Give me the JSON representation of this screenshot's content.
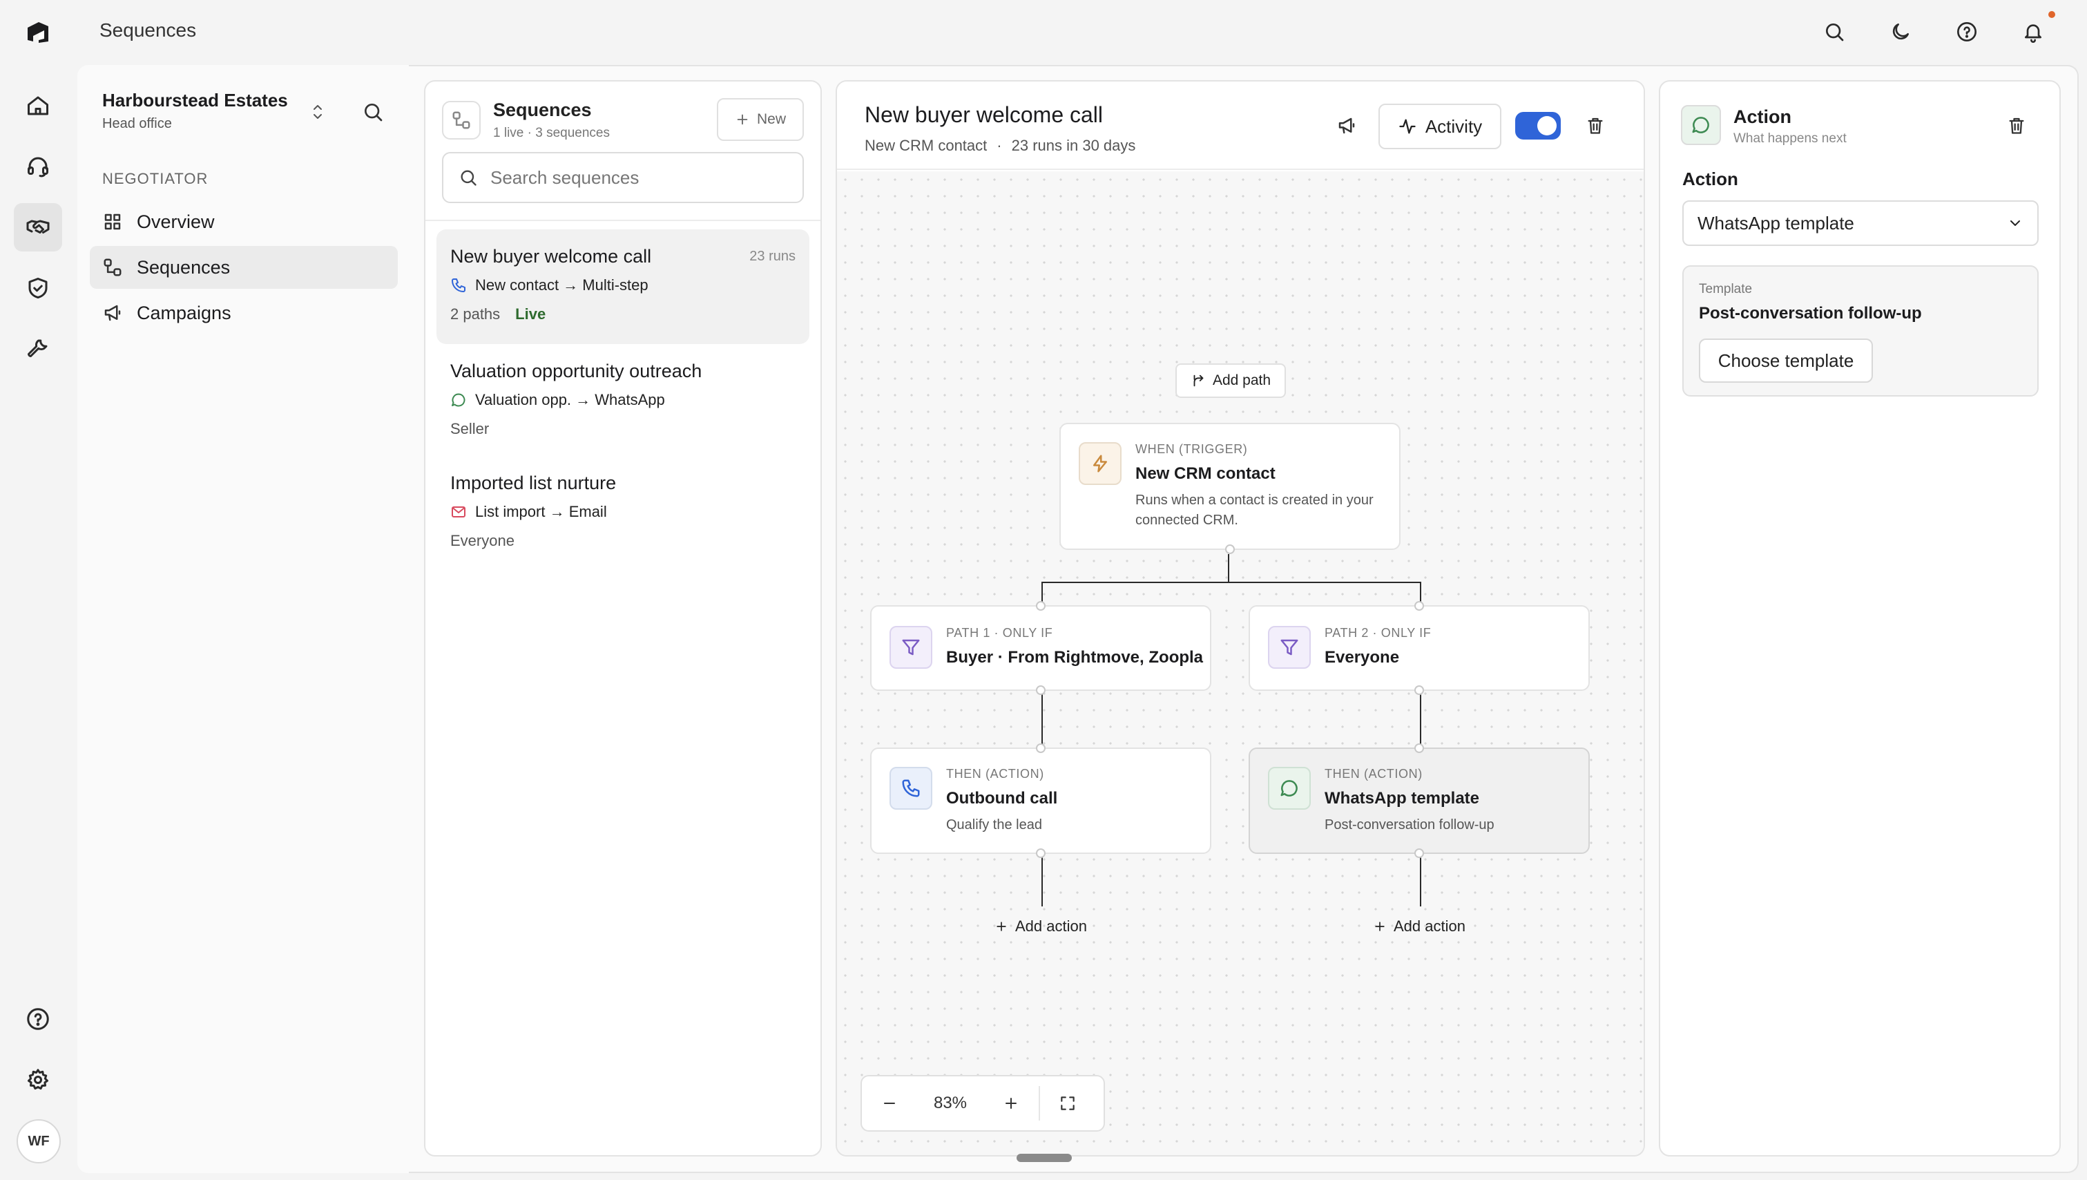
{
  "app": {
    "title": "Sequences"
  },
  "org": {
    "name": "Harbourstead Estates",
    "subtitle": "Head office"
  },
  "user": {
    "initials": "WF"
  },
  "sidebar": {
    "section_label": "NEGOTIATOR",
    "items": [
      {
        "label": "Overview",
        "icon": "grid-icon"
      },
      {
        "label": "Sequences",
        "icon": "sequence-icon",
        "active": true
      },
      {
        "label": "Campaigns",
        "icon": "megaphone-icon"
      }
    ]
  },
  "sequences_panel": {
    "title": "Sequences",
    "subtitle": "1 live · 3 sequences",
    "new_label": "New",
    "search_placeholder": "Search sequences",
    "items": [
      {
        "title": "New buyer welcome call",
        "runs": "23 runs",
        "flow": "New contact → Multi-step",
        "flow_icon": "phone-icon",
        "meta": "2 paths",
        "status": "Live",
        "active": true
      },
      {
        "title": "Valuation opportunity outreach",
        "flow": "Valuation opp. → WhatsApp",
        "flow_icon": "chat-icon",
        "meta": "Seller"
      },
      {
        "title": "Imported list nurture",
        "flow": "List import → Email",
        "flow_icon": "mail-icon",
        "meta": "Everyone"
      }
    ]
  },
  "canvas": {
    "title": "New buyer welcome call",
    "subtitle_trigger": "New CRM contact",
    "subtitle_runs": "23 runs in 30 days",
    "separator": "·",
    "activity_label": "Activity",
    "enabled": true,
    "add_path_label": "Add path",
    "add_action_label": "Add action",
    "zoom": "83%",
    "trigger": {
      "kicker": "WHEN (TRIGGER)",
      "title": "New CRM contact",
      "desc": "Runs when a contact is created in your connected CRM."
    },
    "paths": [
      {
        "kicker": "PATH 1 · ONLY IF",
        "title": "Buyer · From Rightmove, Zoopla"
      },
      {
        "kicker": "PATH 2 · ONLY IF",
        "title": "Everyone"
      }
    ],
    "actions": [
      {
        "kicker": "THEN (ACTION)",
        "title": "Outbound call",
        "desc": "Qualify the lead",
        "icon": "phone-icon"
      },
      {
        "kicker": "THEN (ACTION)",
        "title": "WhatsApp template",
        "desc": "Post-conversation follow-up",
        "icon": "chat-icon",
        "selected": true
      }
    ]
  },
  "config": {
    "title": "Action",
    "subtitle": "What happens next",
    "action_label": "Action",
    "action_value": "WhatsApp template",
    "template_label": "Template",
    "template_value": "Post-conversation follow-up",
    "choose_label": "Choose template"
  },
  "colors": {
    "accent": "#2f64d8",
    "live": "#2e6a2e",
    "whatsapp": "#3d8a52",
    "trigger": "#c98a3d",
    "filter": "#7b5cc4",
    "email": "#d84a5e",
    "notification": "#e0652b"
  }
}
